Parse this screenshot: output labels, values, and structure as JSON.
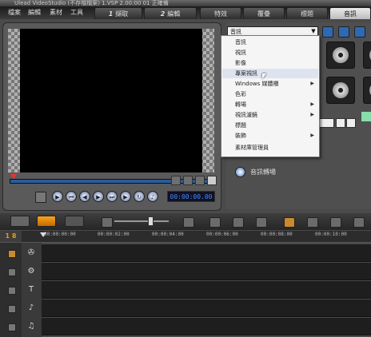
{
  "window": {
    "title_fragment": "Ulead VideoStudio (不存檔檔案) 1.VSP  2.00:00  01  正確備"
  },
  "menu": {
    "items": [
      "檔案",
      "編輯",
      "素材",
      "工具"
    ]
  },
  "steps": [
    {
      "num": "1",
      "label": "擷取"
    },
    {
      "num": "2",
      "label": "編輯"
    },
    {
      "num": "",
      "label": "特效"
    },
    {
      "num": "",
      "label": "覆疊"
    },
    {
      "num": "",
      "label": "標題"
    },
    {
      "num": "",
      "label": "音訊"
    }
  ],
  "library": {
    "selected": "音訊",
    "dropdown_items": [
      {
        "label": "音訊",
        "submenu": false
      },
      {
        "label": "視訊",
        "submenu": false
      },
      {
        "label": "影像",
        "submenu": false
      },
      {
        "label": "專案視訊",
        "submenu": false,
        "highlighted": true
      },
      {
        "label": "Windows 媒體櫃",
        "submenu": true
      },
      {
        "label": "色彩",
        "submenu": false
      },
      {
        "label": "轉場",
        "submenu": true
      },
      {
        "label": "視訊濾鏡",
        "submenu": true
      },
      {
        "label": "標題",
        "submenu": false
      },
      {
        "label": "裝飾",
        "submenu": true
      },
      {
        "label": "素材庫管理員",
        "submenu": false
      }
    ],
    "options_label": "音訊轉場",
    "disc_labels": [
      "",
      "",
      "",
      ""
    ]
  },
  "player": {
    "timecode": "00:00:00.00",
    "controls": [
      "play-icon",
      "home-icon",
      "prev-frame-icon",
      "next-frame-icon",
      "end-icon",
      "repeat-icon",
      "volume-icon"
    ]
  },
  "timeline": {
    "ruler_head": "1 8",
    "ticks": [
      "00:00:00:00",
      "00:00:02:00",
      "00:00:04:00",
      "00:00:06:00",
      "00:00:08:00",
      "00:00:10:00"
    ],
    "track_icons": [
      "film-icon",
      "overlay-icon",
      "title-icon",
      "voice-icon",
      "music-icon"
    ],
    "track_glyphs": [
      "✇",
      "⚙",
      "T",
      "♪",
      "♫"
    ]
  }
}
